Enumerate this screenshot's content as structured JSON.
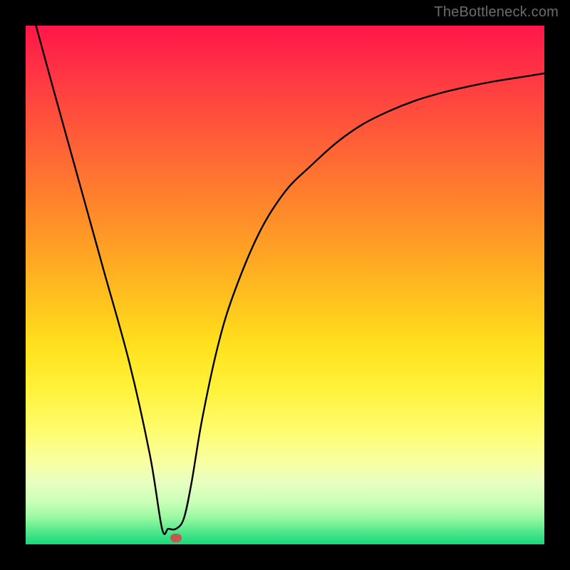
{
  "watermark": "TheBottleneck.com",
  "chart_data": {
    "type": "line",
    "title": "",
    "xlabel": "",
    "ylabel": "",
    "xlim": [
      0,
      1
    ],
    "ylim": [
      0,
      1
    ],
    "series": [
      {
        "name": "curve",
        "x": [
          0.02,
          0.05,
          0.1,
          0.15,
          0.2,
          0.24,
          0.263,
          0.275,
          0.29,
          0.305,
          0.32,
          0.34,
          0.37,
          0.4,
          0.45,
          0.5,
          0.55,
          0.6,
          0.65,
          0.7,
          0.75,
          0.8,
          0.85,
          0.9,
          0.95,
          1.0
        ],
        "values": [
          1.0,
          0.89,
          0.71,
          0.53,
          0.35,
          0.17,
          0.03,
          0.03,
          0.03,
          0.05,
          0.12,
          0.24,
          0.38,
          0.48,
          0.6,
          0.68,
          0.73,
          0.775,
          0.81,
          0.835,
          0.855,
          0.87,
          0.882,
          0.892,
          0.9,
          0.908
        ]
      }
    ],
    "marker": {
      "x": 0.29,
      "y": 0.012
    },
    "background_gradient_stops": [
      {
        "pos": 0.0,
        "color": "#ff1648"
      },
      {
        "pos": 0.5,
        "color": "#ffc61e"
      },
      {
        "pos": 0.8,
        "color": "#fffc6e"
      },
      {
        "pos": 1.0,
        "color": "#18d87a"
      }
    ]
  }
}
